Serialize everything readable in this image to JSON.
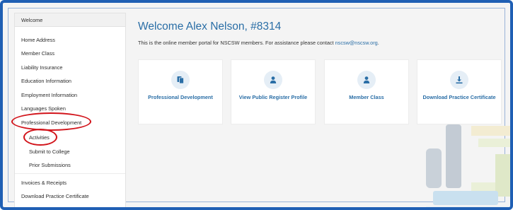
{
  "sidebar": {
    "items": [
      {
        "label": "Welcome"
      },
      {
        "label": "Home Address"
      },
      {
        "label": "Member Class"
      },
      {
        "label": "Liability Insurance"
      },
      {
        "label": "Education Information"
      },
      {
        "label": "Employment Information"
      },
      {
        "label": "Languages Spoken"
      },
      {
        "label": "Professional Development"
      },
      {
        "label": "Activities"
      },
      {
        "label": "Submit to College"
      },
      {
        "label": "Prior Submissions"
      },
      {
        "label": "Invoices & Receipts"
      },
      {
        "label": "Download Practice Certificate"
      }
    ]
  },
  "main": {
    "title": "Welcome Alex Nelson, #8314",
    "intro_text": "This is the online member portal for NSCSW members. For assistance please contact ",
    "intro_link": "nscsw@nscsw.org",
    "intro_end": ".",
    "cards": [
      {
        "label": "Professional Development",
        "icon": "documents-icon"
      },
      {
        "label": "View Public Register Profile",
        "icon": "person-icon"
      },
      {
        "label": "Member Class",
        "icon": "person-icon"
      },
      {
        "label": "Download Practice Certificate",
        "icon": "download-icon"
      }
    ]
  },
  "colors": {
    "accent": "#2a6ea6",
    "frame": "#1f5fb4",
    "annotation": "#d2141b"
  }
}
